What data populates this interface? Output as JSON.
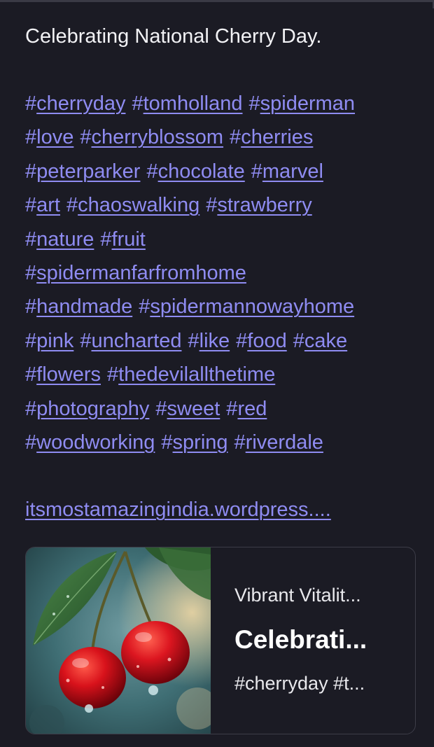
{
  "post": {
    "text": "Celebrating National Cherry Day.",
    "hashtag_lines": [
      [
        "cherryday",
        "tomholland",
        "spiderman"
      ],
      [
        "love",
        "cherryblossom",
        "cherries"
      ],
      [
        "peterparker",
        "chocolate",
        "marvel"
      ],
      [
        "art",
        "chaoswalking",
        "strawberry"
      ],
      [
        "nature",
        "fruit"
      ],
      [
        "spidermanfarfromhome"
      ],
      [
        "handmade",
        "spidermannowayhome"
      ],
      [
        "pink",
        "uncharted",
        "like",
        "food",
        "cake"
      ],
      [
        "flowers",
        "thedevilallthetime"
      ],
      [
        "photography",
        "sweet",
        "red"
      ],
      [
        "woodworking",
        "spring",
        "riverdale"
      ]
    ],
    "link_text": "itsmostamazingindia.wordpress...."
  },
  "card": {
    "site": "Vibrant Vitalit...",
    "title": "Celebrati...",
    "description": "#cherryday #t...",
    "image_icon": "cherries-photo"
  },
  "colors": {
    "background": "#1b1b24",
    "link": "#8f8cf2",
    "text": "#ffffff",
    "card_border": "#3d3d48"
  }
}
